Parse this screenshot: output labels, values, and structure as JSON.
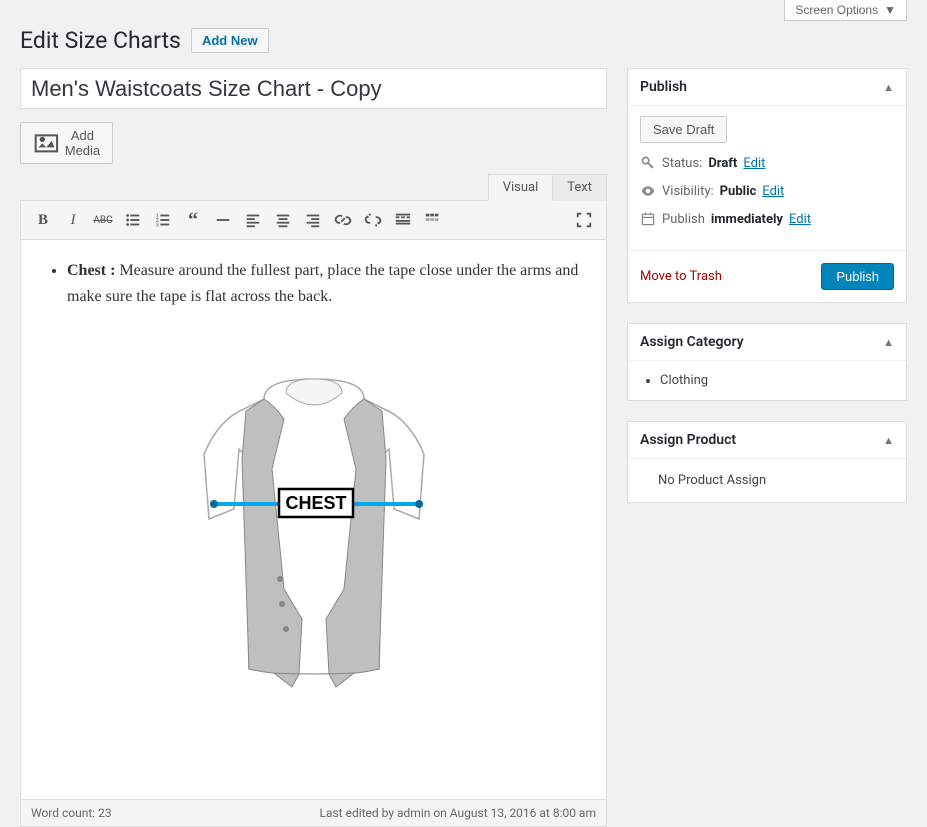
{
  "screenOptions": {
    "label": "Screen Options"
  },
  "header": {
    "title": "Edit Size Charts",
    "addNew": "Add New"
  },
  "post": {
    "title": "Men's Waistcoats Size Chart - Copy"
  },
  "media": {
    "addMediaLabel": "Add Media"
  },
  "editor": {
    "tabs": {
      "visual": "Visual",
      "text": "Text"
    },
    "content": {
      "bulletLabel": "Chest :",
      "bulletText": " Measure around the fullest part, place the tape close under the arms and make sure the tape is flat across the back."
    },
    "imageLabel": "CHEST",
    "wordCount": "Word count: 23",
    "lastEdited": "Last edited by admin on August 13, 2016 at 8:00 am"
  },
  "publish": {
    "title": "Publish",
    "saveDraft": "Save Draft",
    "statusLabel": "Status:",
    "statusValue": "Draft",
    "edit": "Edit",
    "visibilityLabel": "Visibility:",
    "visibilityValue": "Public",
    "publishLabel": "Publish",
    "publishValue": "immediately",
    "trash": "Move to Trash",
    "publishBtn": "Publish"
  },
  "category": {
    "title": "Assign Category",
    "items": [
      "Clothing"
    ]
  },
  "product": {
    "title": "Assign Product",
    "empty": "No Product Assign"
  }
}
